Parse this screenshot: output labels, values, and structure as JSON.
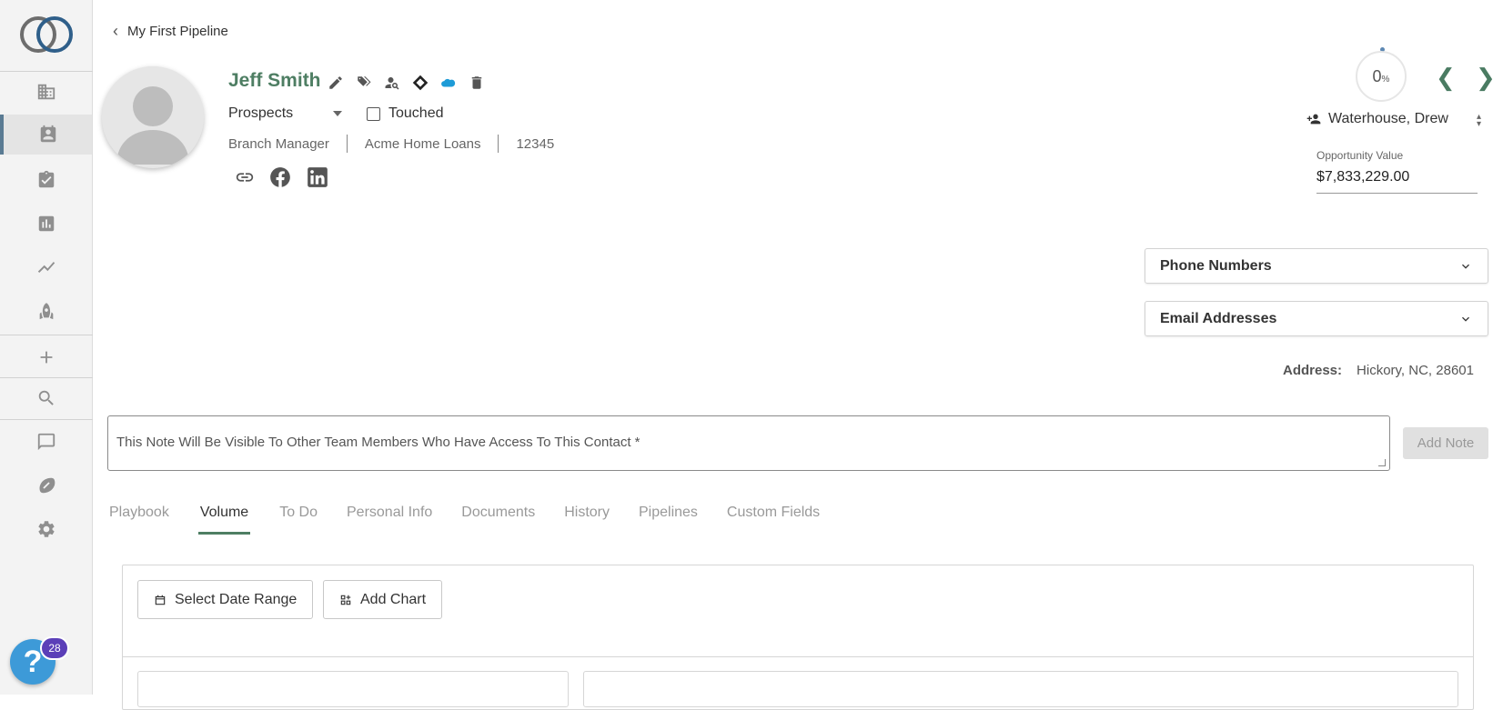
{
  "sidebar": {
    "logo": "ring-logo",
    "items": [
      {
        "icon": "building-icon"
      },
      {
        "icon": "contact-card-icon",
        "active": true
      },
      {
        "icon": "clipboard-check-icon"
      },
      {
        "icon": "bar-chart-icon"
      },
      {
        "icon": "trending-line-icon"
      },
      {
        "icon": "rocket-icon"
      },
      {
        "icon": "plus-icon"
      },
      {
        "icon": "search-icon"
      },
      {
        "icon": "chat-icon"
      },
      {
        "icon": "football-icon"
      },
      {
        "icon": "gear-icon"
      }
    ],
    "help_label": "?",
    "help_badge": "28"
  },
  "header": {
    "back_label": "My First Pipeline",
    "contact_name": "Jeff Smith",
    "name_icons": [
      "edit-icon",
      "tags-icon",
      "person-search-icon",
      "diamond-icon",
      "salesforce-cloud-icon",
      "trash-icon"
    ],
    "status": "Prospects",
    "touched_label": "Touched",
    "touched": false,
    "title": "Branch Manager",
    "company": "Acme Home Loans",
    "id_number": "12345",
    "social_icons": [
      "link-icon",
      "facebook-icon",
      "linkedin-icon"
    ]
  },
  "right": {
    "progress_value": "0",
    "progress_unit": "%",
    "owner": "Waterhouse, Drew",
    "opportunity_label": "Opportunity Value",
    "opportunity_value": "$7,833,229.00",
    "phone_label": "Phone Numbers",
    "email_label": "Email Addresses",
    "address_label": "Address:",
    "address_value": "Hickory, NC, 28601"
  },
  "note": {
    "placeholder": "This Note Will Be Visible To Other Team Members Who Have Access To This Contact *",
    "add_label": "Add Note"
  },
  "tabs": [
    {
      "label": "Playbook"
    },
    {
      "label": "Volume",
      "active": true
    },
    {
      "label": "To Do"
    },
    {
      "label": "Personal Info"
    },
    {
      "label": "Documents"
    },
    {
      "label": "History"
    },
    {
      "label": "Pipelines"
    },
    {
      "label": "Custom Fields"
    }
  ],
  "panel": {
    "date_range_label": "Select Date Range",
    "add_chart_label": "Add Chart"
  },
  "colors": {
    "accent_green": "#4e7e63",
    "help_blue": "#3d9ad8",
    "badge_purple": "#5b3fb8"
  }
}
